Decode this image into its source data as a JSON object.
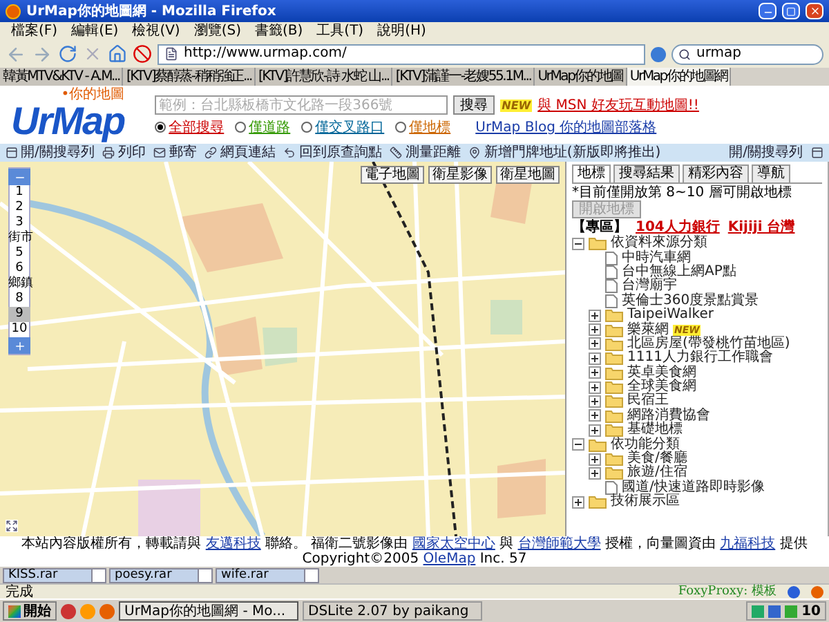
{
  "window": {
    "title": "UrMap你的地圖網 - Mozilla Firefox"
  },
  "menu": [
    "檔案(F)",
    "編輯(E)",
    "檢視(V)",
    "瀏覽(S)",
    "書籤(B)",
    "工具(T)",
    "說明(H)"
  ],
  "address_bar": {
    "value": "http://www.urmap.com/"
  },
  "search_bar": {
    "value": "urmap"
  },
  "tabs": [
    {
      "label": "韓黃MTV&KTV - A.M...",
      "selected": false
    },
    {
      "label": "[KTV]蔡醇蒸-稍稍強正...",
      "selected": false
    },
    {
      "label": "[KTV]許慧欣-詩 水蛇 山...",
      "selected": false
    },
    {
      "label": "[KTV]蒲謹一-老嫂55.1M...",
      "selected": false
    },
    {
      "label": "UrMap你的地圖",
      "selected": false
    },
    {
      "label": "UrMap你的地圖網",
      "selected": true
    }
  ],
  "header": {
    "logo": "UrMap",
    "logo_tagline": "•你的地圖",
    "search": {
      "placeholder": "範例：台北縣板橋市文化路一段366號",
      "button": "搜尋"
    },
    "new_badge": "NEW",
    "msn_link": "與 MSN 好友玩互動地圖!!",
    "search_modes": [
      {
        "label": "全部搜尋",
        "selected": true,
        "color": "#cc0000"
      },
      {
        "label": "僅道路",
        "selected": false,
        "color": "#339900"
      },
      {
        "label": "僅交叉路口",
        "selected": false,
        "color": "#006699"
      },
      {
        "label": "僅地標",
        "selected": false,
        "color": "#cc6600"
      }
    ],
    "blog_link": "UrMap Blog 你的地圖部落格"
  },
  "toolbar": {
    "items": [
      "開/關搜尋列",
      "列印",
      "郵寄",
      "網頁連結",
      "回到原查詢點",
      "測量距離",
      "新增門牌地址(新版即將推出)"
    ],
    "right_item": "開/關搜尋列"
  },
  "map": {
    "zoom_levels": [
      {
        "label": "1",
        "selected": false
      },
      {
        "label": "2",
        "selected": false
      },
      {
        "label": "3",
        "selected": false
      },
      {
        "label": "街市",
        "selected": false
      },
      {
        "label": "5",
        "selected": false
      },
      {
        "label": "6",
        "selected": false
      },
      {
        "label": "鄉鎮",
        "selected": false
      },
      {
        "label": "8",
        "selected": false
      },
      {
        "label": "9",
        "selected": true
      },
      {
        "label": "10",
        "selected": false
      }
    ],
    "map_types": [
      "電子地圖",
      "衛星影像",
      "衛星地圖"
    ]
  },
  "footer": [
    {
      "kind": "text",
      "text": "本站內容版權所有，轉載請與"
    },
    {
      "kind": "link",
      "text": "友邁科技"
    },
    {
      "kind": "text",
      "text": "聯絡。 福衛二號影像由"
    },
    {
      "kind": "link",
      "text": "國家太空中心"
    },
    {
      "kind": "text",
      "text": "與"
    },
    {
      "kind": "link",
      "text": "台灣師範大學"
    },
    {
      "kind": "text",
      "text": "授權，向量圖資由"
    },
    {
      "kind": "link",
      "text": "九福科技"
    },
    {
      "kind": "text",
      "text": "提供 Copyright©2005"
    },
    {
      "kind": "link",
      "text": "OleMap"
    },
    {
      "kind": "text",
      "text": "Inc. 57"
    }
  ],
  "side_panel": {
    "tabs": [
      {
        "label": "地標",
        "selected": true
      },
      {
        "label": "搜尋結果",
        "selected": false
      },
      {
        "label": "精彩內容",
        "selected": false
      },
      {
        "label": "導航",
        "selected": false
      }
    ],
    "note": "*目前僅開放第 8~10 層可開啟地標",
    "open_button": {
      "label": "開啟地標",
      "disabled": true
    },
    "promo": {
      "label": "【專區】",
      "links": [
        "104人力銀行",
        "Kijiji 台灣"
      ]
    },
    "tree": [
      {
        "label": "依資料來源分類",
        "kind": "folder",
        "expanded": true,
        "children": [
          {
            "label": "中時汽車網",
            "kind": "page"
          },
          {
            "label": "台中無線上網AP點",
            "kind": "page"
          },
          {
            "label": "台灣廟宇",
            "kind": "page"
          },
          {
            "label": "英倫士360度景點賞景",
            "kind": "page"
          },
          {
            "label": "TaipeiWalker",
            "kind": "folder",
            "expanded": false
          },
          {
            "label": "樂萊網",
            "kind": "folder",
            "expanded": false,
            "badge": "NEW"
          },
          {
            "label": "北區房屋(帶發桃竹苗地區)",
            "kind": "folder",
            "expanded": false
          },
          {
            "label": "1111人力銀行工作職會",
            "kind": "folder",
            "expanded": false
          },
          {
            "label": "英卓美食網",
            "kind": "folder",
            "expanded": false
          },
          {
            "label": "全球美食網",
            "kind": "folder",
            "expanded": false
          },
          {
            "label": "民宿王",
            "kind": "folder",
            "expanded": false
          },
          {
            "label": "網路消費協會",
            "kind": "folder",
            "expanded": false
          },
          {
            "label": "基礎地標",
            "kind": "folder",
            "expanded": false
          }
        ]
      },
      {
        "label": "依功能分類",
        "kind": "folder",
        "expanded": true,
        "children": [
          {
            "label": "美食/餐廳",
            "kind": "folder",
            "expanded": false
          },
          {
            "label": "旅遊/住宿",
            "kind": "folder",
            "expanded": false
          },
          {
            "label": "國道/快速道路即時影像",
            "kind": "page"
          }
        ]
      },
      {
        "label": "技術展示區",
        "kind": "folder",
        "expanded": false
      }
    ]
  },
  "downloads": [
    "KISS.rar",
    "poesy.rar",
    "wife.rar"
  ],
  "status_bar": {
    "text": "完成",
    "proxy": "FoxyProxy: 模板"
  },
  "taskbar": {
    "start": "開始",
    "tasks": [
      {
        "label": "UrMap你的地圖網 - Mo...",
        "selected": true
      },
      {
        "label": "DSLite 2.07 by paikang",
        "selected": false
      }
    ],
    "clock": "10"
  }
}
